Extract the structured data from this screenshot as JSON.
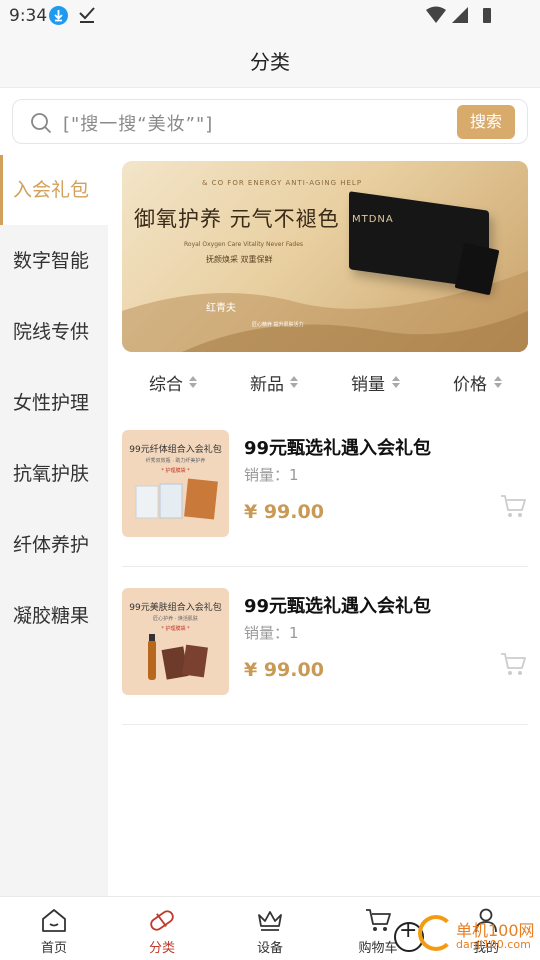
{
  "status_bar": {
    "time": "9:34"
  },
  "header": {
    "title": "分类"
  },
  "search": {
    "placeholder": "[\"搜一搜“美妆”\"]",
    "button_label": "搜索"
  },
  "sidebar": {
    "items": [
      {
        "label": "入会礼包",
        "active": true
      },
      {
        "label": "数字智能",
        "active": false
      },
      {
        "label": "院线专供",
        "active": false
      },
      {
        "label": "女性护理",
        "active": false
      },
      {
        "label": "抗氧护肤",
        "active": false
      },
      {
        "label": "纤体养护",
        "active": false
      },
      {
        "label": "凝胶糖果",
        "active": false
      }
    ]
  },
  "banner": {
    "top_small": "& CO FOR ENERGY ANTI-AGING HELP",
    "headline": "御氧护养  元气不褪色",
    "sub_en": "Royal Oxygen Care  Vitality Never Fades",
    "tagline": "抚颜焕采  双重保鲜",
    "brand": "红青夫",
    "footer": "匠心精养 提升肌肤活力",
    "product_label": "MTDNA"
  },
  "sort_bar": [
    "综合",
    "新品",
    "销量",
    "价格"
  ],
  "products": [
    {
      "name": "99元甄选礼遇入会礼包",
      "sales": "销量：1",
      "price": "¥ 99.00",
      "thumb_title": "99元纤体组合入会礼包",
      "thumb_sub": "纤秀双效瓶 · 助力纤美护养",
      "thumb_tag": "* 护理膜袋 *"
    },
    {
      "name": "99元甄选礼遇入会礼包",
      "sales": "销量：1",
      "price": "¥ 99.00",
      "thumb_title": "99元美肤组合入会礼包",
      "thumb_sub": "匠心护养 · 焕活肌肤",
      "thumb_tag": "* 护理膜袋 *"
    }
  ],
  "bottom_nav": [
    {
      "label": "首页",
      "icon": "home-icon",
      "active": false
    },
    {
      "label": "分类",
      "icon": "category-capsule-icon",
      "active": true
    },
    {
      "label": "设备",
      "icon": "crown-icon",
      "active": false
    },
    {
      "label": "购物车",
      "icon": "cart-icon",
      "active": false
    },
    {
      "label": "我的",
      "icon": "user-icon",
      "active": false
    }
  ],
  "watermark": {
    "line1": "单机100网",
    "line2": "danji100.com"
  },
  "colors": {
    "accent": "#d2a05b",
    "price": "#c89a55",
    "active_nav": "#c0392b",
    "search_button": "#d8aa6b"
  }
}
